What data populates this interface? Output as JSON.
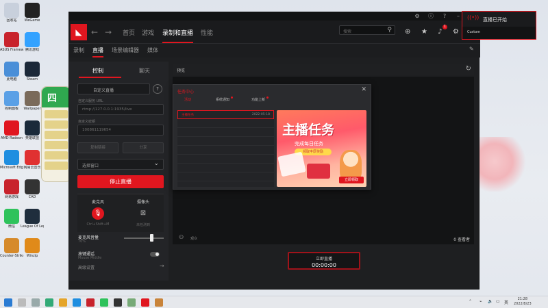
{
  "desktop": {
    "icons": [
      {
        "label": "回收站",
        "color": "#c8d0dc"
      },
      {
        "label": "WeGame",
        "color": "#222222"
      },
      {
        "label": "ASUS Framework",
        "color": "#c8232c"
      },
      {
        "label": "腾讯游戏",
        "color": "#33a2ff"
      },
      {
        "label": "此电脑",
        "color": "#4a8fd8"
      },
      {
        "label": "Steam",
        "color": "#1b2838"
      },
      {
        "label": "控制面板",
        "color": "#5aa0e6"
      },
      {
        "label": "Wallpaper",
        "color": "#7a6a5a"
      },
      {
        "label": "AMD Radeon",
        "color": "#e0161f"
      },
      {
        "label": "英雄联盟",
        "color": "#1a2a3a"
      },
      {
        "label": "Microsoft Edge",
        "color": "#1f8ee0"
      },
      {
        "label": "网易云音乐",
        "color": "#e03131"
      },
      {
        "label": "网易游戏",
        "color": "#c8232c"
      },
      {
        "label": "CAD",
        "color": "#333333"
      },
      {
        "label": "微信",
        "color": "#2ec25b"
      },
      {
        "label": "League Of Legends",
        "color": "#1f2e3d"
      },
      {
        "label": "Counter-Strike",
        "color": "#d68a2a"
      },
      {
        "label": "Winzip",
        "color": "#e08a1a"
      }
    ]
  },
  "app": {
    "nav": {
      "tabs": [
        "首页",
        "游戏",
        "录制和直播",
        "性能"
      ],
      "active_tab": "录制和直播",
      "search_placeholder": "搜索",
      "bell_badge": "1"
    },
    "subnav": {
      "tabs": [
        "录制",
        "直播",
        "场景编辑器",
        "媒体"
      ],
      "active": "直播"
    },
    "panel": {
      "tabs": [
        "控制",
        "聊天"
      ],
      "active": "控制",
      "user_field": "自定义直播",
      "help": "?",
      "url_label": "自定义服务 URL",
      "url_value": "rtmp://127.0.0.1:1935/live",
      "key_label": "自定义密钥",
      "key_value": "100861119654",
      "btn_copy": "复制链接",
      "btn_share": "分享",
      "dropdown": "选择窗口",
      "stop_btn": "停止直播",
      "mic_title": "麦克风",
      "mic_sub": "Ctrl+Shift+M",
      "cam_title": "摄像头",
      "cam_sub": "未检测到",
      "vol_label": "麦克风音量",
      "vol_value": "70%",
      "volume": 0.7,
      "ptt_label": "按键通话",
      "ptt_sub": "Mouse Middle",
      "advanced": "高级设置"
    },
    "preview": {
      "title": "预览",
      "audience": "观众",
      "viewers": "0 查看者",
      "golive_label": "立即直播",
      "golive_time": "00:00:00"
    },
    "popup": {
      "title": "任务中心",
      "tabs": [
        "活动",
        "系统通知",
        "功能上新"
      ],
      "rows": [
        {
          "name": "主播任务",
          "date": "2022-05-18"
        },
        {
          "name": "",
          "date": ""
        },
        {
          "name": "",
          "date": ""
        },
        {
          "name": "",
          "date": ""
        },
        {
          "name": "",
          "date": ""
        },
        {
          "name": "",
          "date": ""
        },
        {
          "name": "",
          "date": ""
        },
        {
          "name": "",
          "date": ""
        }
      ],
      "banner_title": "主播任务",
      "banner_sub": "完成每日任务",
      "banner_pill": "领取丰厚奖励",
      "banner_cta": "立即领取"
    }
  },
  "notification": {
    "title": "直播已开始",
    "sub": "Custom"
  },
  "taskbar": {
    "lang": "英",
    "time": "21:28",
    "date": "2022/8/23"
  },
  "colors": {
    "accent": "#e0161f",
    "window_bg": "#1e1f21"
  }
}
